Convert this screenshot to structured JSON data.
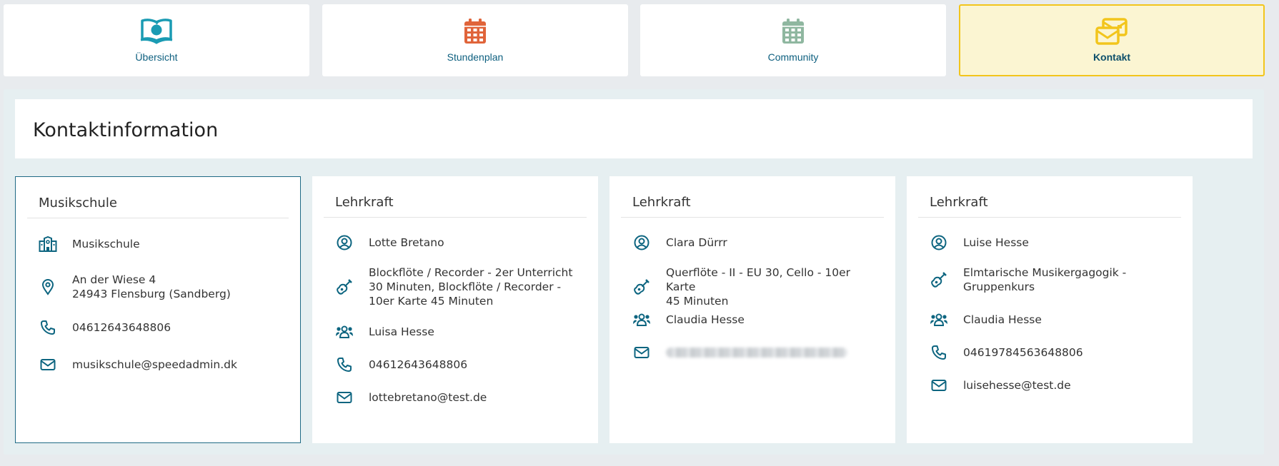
{
  "nav": {
    "tabs": [
      {
        "label": "Übersicht",
        "icon": "book-apple-icon",
        "color": "#1a9bb3"
      },
      {
        "label": "Stundenplan",
        "icon": "calendar-icon",
        "color": "#e0643a"
      },
      {
        "label": "Community",
        "icon": "calendar-icon",
        "color": "#8fb7a0"
      },
      {
        "label": "Kontakt",
        "icon": "envelopes-icon",
        "color": "#f2c51c",
        "active": true
      }
    ]
  },
  "page": {
    "title": "Kontaktinformation"
  },
  "cards": [
    {
      "title": "Musikschule",
      "rows": [
        {
          "icon": "school-building-icon",
          "text": "Musikschule"
        },
        {
          "icon": "location-pin-icon",
          "text": "An der Wiese 4\n24943 Flensburg (Sandberg)"
        },
        {
          "icon": "phone-icon",
          "text": "04612643648806"
        },
        {
          "icon": "mail-icon",
          "text": "musikschule@speedadmin.dk"
        }
      ]
    },
    {
      "title": "Lehrkraft",
      "rows": [
        {
          "icon": "user-circle-icon",
          "text": "Lotte Bretano"
        },
        {
          "icon": "guitar-icon",
          "text": "Blockflöte / Recorder - 2er Unterricht\n30 Minuten, Blockflöte / Recorder -\n10er Karte 45 Minuten"
        },
        {
          "icon": "users-icon",
          "text": "Luisa Hesse"
        },
        {
          "icon": "phone-icon",
          "text": "04612643648806"
        },
        {
          "icon": "mail-icon",
          "text": "lottebretano@test.de"
        }
      ]
    },
    {
      "title": "Lehrkraft",
      "rows": [
        {
          "icon": "user-circle-icon",
          "text": "Clara Dürrr"
        },
        {
          "icon": "guitar-icon",
          "text": "Querflöte - II - EU 30, Cello - 10er Karte\n45 Minuten"
        },
        {
          "icon": "users-icon",
          "text": "Claudia Hesse"
        },
        {
          "icon": "mail-icon",
          "text": ""
        }
      ]
    },
    {
      "title": "Lehrkraft",
      "rows": [
        {
          "icon": "user-circle-icon",
          "text": "Luise Hesse"
        },
        {
          "icon": "guitar-icon",
          "text": "Elmtarische Musikergagogik -\nGruppenkurs"
        },
        {
          "icon": "users-icon",
          "text": "Claudia Hesse"
        },
        {
          "icon": "phone-icon",
          "text": "04619784563648806"
        },
        {
          "icon": "mail-icon",
          "text": "luisehesse@test.de"
        }
      ]
    }
  ]
}
